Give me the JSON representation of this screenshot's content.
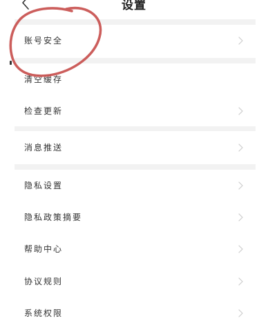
{
  "header": {
    "title": "设置",
    "back_icon": "chevron-left-icon"
  },
  "settings": {
    "items": [
      {
        "label": "账号安全"
      },
      {
        "label": "清空缓存"
      },
      {
        "label": "检查更新"
      },
      {
        "label": "消息推送"
      },
      {
        "label": "隐私设置"
      },
      {
        "label": "隐私政策摘要"
      },
      {
        "label": "帮助中心"
      },
      {
        "label": "协议规则"
      },
      {
        "label": "系统权限"
      }
    ],
    "chevron_icon": "chevron-right-icon"
  },
  "colors": {
    "background": "#ffffff",
    "divider": "#f2f2f2",
    "text": "#333333",
    "chevron": "#cccccc",
    "annotation_circle": "#c8504e"
  }
}
